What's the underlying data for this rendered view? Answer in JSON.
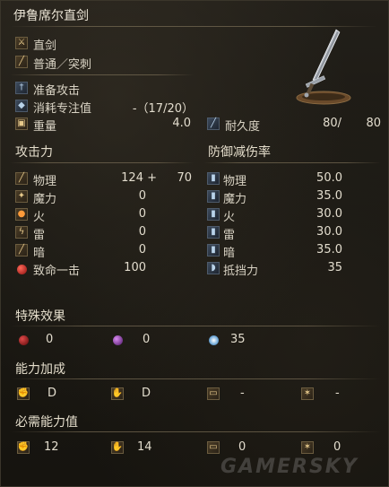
{
  "weapon": {
    "name": "伊鲁席尔直剑",
    "weapon_type": "直剑",
    "attack_type": "普通／突刺",
    "skill": "准备攻击",
    "fp_cost_label": "消耗专注值",
    "fp_cost_value": "-（17/20）",
    "weight_label": "重量",
    "weight_value": "4.0",
    "durability_label": "耐久度",
    "durability_current": "80/",
    "durability_max": "80"
  },
  "attack": {
    "header": "攻击力",
    "rows": [
      {
        "label": "物理",
        "value": "124 +",
        "bonus": "70",
        "icon": "sword-icon"
      },
      {
        "label": "魔力",
        "value": "0",
        "bonus": "",
        "icon": "magic-icon"
      },
      {
        "label": "火",
        "value": "0",
        "bonus": "",
        "icon": "fire-icon"
      },
      {
        "label": "雷",
        "value": "0",
        "bonus": "",
        "icon": "lightning-icon"
      },
      {
        "label": "暗",
        "value": "0",
        "bonus": "",
        "icon": "dark-icon"
      },
      {
        "label": "致命一击",
        "value": "100",
        "bonus": "",
        "icon": "critical-icon"
      }
    ]
  },
  "defense": {
    "header": "防御减伤率",
    "rows": [
      {
        "label": "物理",
        "value": "50.0",
        "icon": "physical-guard-icon"
      },
      {
        "label": "魔力",
        "value": "35.0",
        "icon": "magic-guard-icon"
      },
      {
        "label": "火",
        "value": "30.0",
        "icon": "fire-guard-icon"
      },
      {
        "label": "雷",
        "value": "30.0",
        "icon": "lightning-guard-icon"
      },
      {
        "label": "暗",
        "value": "35.0",
        "icon": "dark-guard-icon"
      },
      {
        "label": "抵挡力",
        "value": "35",
        "icon": "stability-icon"
      }
    ]
  },
  "special_effects": {
    "header": "特殊效果",
    "items": [
      {
        "value": "0",
        "icon": "bleed-icon",
        "color": "#a01818"
      },
      {
        "value": "0",
        "icon": "poison-icon",
        "color": "#9a3fb3"
      },
      {
        "value": "35",
        "icon": "frost-icon",
        "color": "#bfe2ff"
      }
    ]
  },
  "scaling": {
    "header": "能力加成",
    "items": [
      {
        "value": "D",
        "icon": "strength-icon"
      },
      {
        "value": "D",
        "icon": "dexterity-icon"
      },
      {
        "value": "-",
        "icon": "intelligence-icon"
      },
      {
        "value": "-",
        "icon": "faith-icon"
      }
    ]
  },
  "requirements": {
    "header": "必需能力值",
    "items": [
      {
        "value": "12",
        "icon": "strength-icon"
      },
      {
        "value": "14",
        "icon": "dexterity-icon"
      },
      {
        "value": "0",
        "icon": "intelligence-icon"
      },
      {
        "value": "0",
        "icon": "faith-icon"
      }
    ]
  },
  "watermark": "GAMERSKY"
}
